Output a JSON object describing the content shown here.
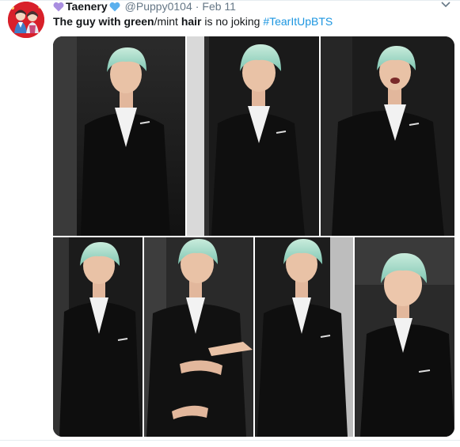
{
  "tweet": {
    "display_name": "Taenery",
    "handle": "@Puppy0104",
    "separator": "·",
    "date": "Feb 11",
    "text": {
      "part1": "The guy with green",
      "part2": "/mint ",
      "part3": "hair",
      "part4": " is no joking ",
      "hashtag": "#TearItUpBTS"
    }
  },
  "icons": {
    "name_emoji_1": "purple-heart-icon",
    "name_emoji_2": "blue-heart-icon",
    "menu": "chevron-down-icon"
  },
  "colors": {
    "link": "#1b95e0",
    "secondary_text": "#657786",
    "primary_text": "#14171a",
    "purple_heart": "#a98ee0",
    "blue_heart": "#5ab0ee"
  }
}
